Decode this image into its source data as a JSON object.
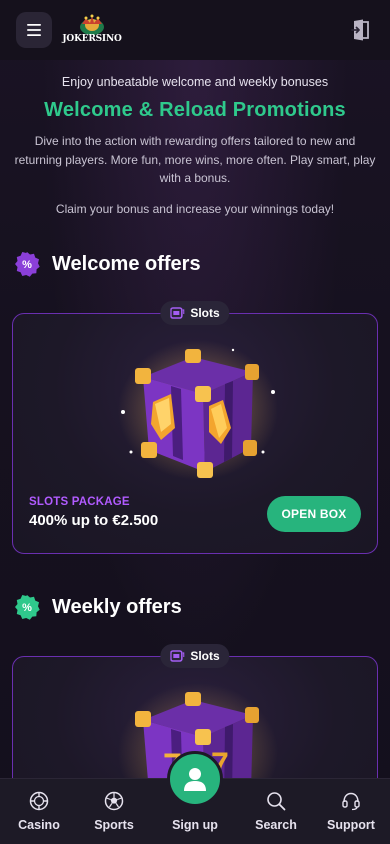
{
  "header": {
    "logo_text": "JOKERSINO",
    "menu_icon": "hamburger-icon",
    "login_icon": "door-enter-icon"
  },
  "hero": {
    "eyebrow": "Enjoy unbeatable welcome and weekly bonuses",
    "title": "Welcome & Reload Promotions",
    "description": "Dive into the action with rewarding offers tailored to new and returning players. More fun, more wins, more often. Play smart, play with a bonus.",
    "claim": "Claim your bonus and increase your winnings today!"
  },
  "sections": [
    {
      "title": "Welcome offers",
      "badge_icon": "percent-badge-icon",
      "badge_color": "#8b3fd9",
      "cards": [
        {
          "tag": "Slots",
          "tag_icon": "slot-icon",
          "art": "mystery-box-gems-icon",
          "subtitle": "SLOTS PACKAGE",
          "amount": "400% up to €2.500",
          "button": "OPEN BOX"
        }
      ]
    },
    {
      "title": "Weekly offers",
      "badge_icon": "percent-badge-icon",
      "badge_color": "#2fc98c",
      "cards": [
        {
          "tag": "Slots",
          "tag_icon": "slot-icon",
          "art": "mystery-box-sevens-icon"
        }
      ]
    }
  ],
  "bottom_nav": [
    {
      "label": "Casino",
      "icon": "casino-chip-icon"
    },
    {
      "label": "Sports",
      "icon": "soccer-ball-icon"
    },
    {
      "label": "Sign up",
      "icon": "user-icon"
    },
    {
      "label": "Search",
      "icon": "search-icon"
    },
    {
      "label": "Support",
      "icon": "headset-icon"
    }
  ],
  "colors": {
    "accent_green": "#2fc98c",
    "button_green": "#27b47d",
    "accent_purple": "#b15bff",
    "card_border": "#6a2fb0"
  }
}
